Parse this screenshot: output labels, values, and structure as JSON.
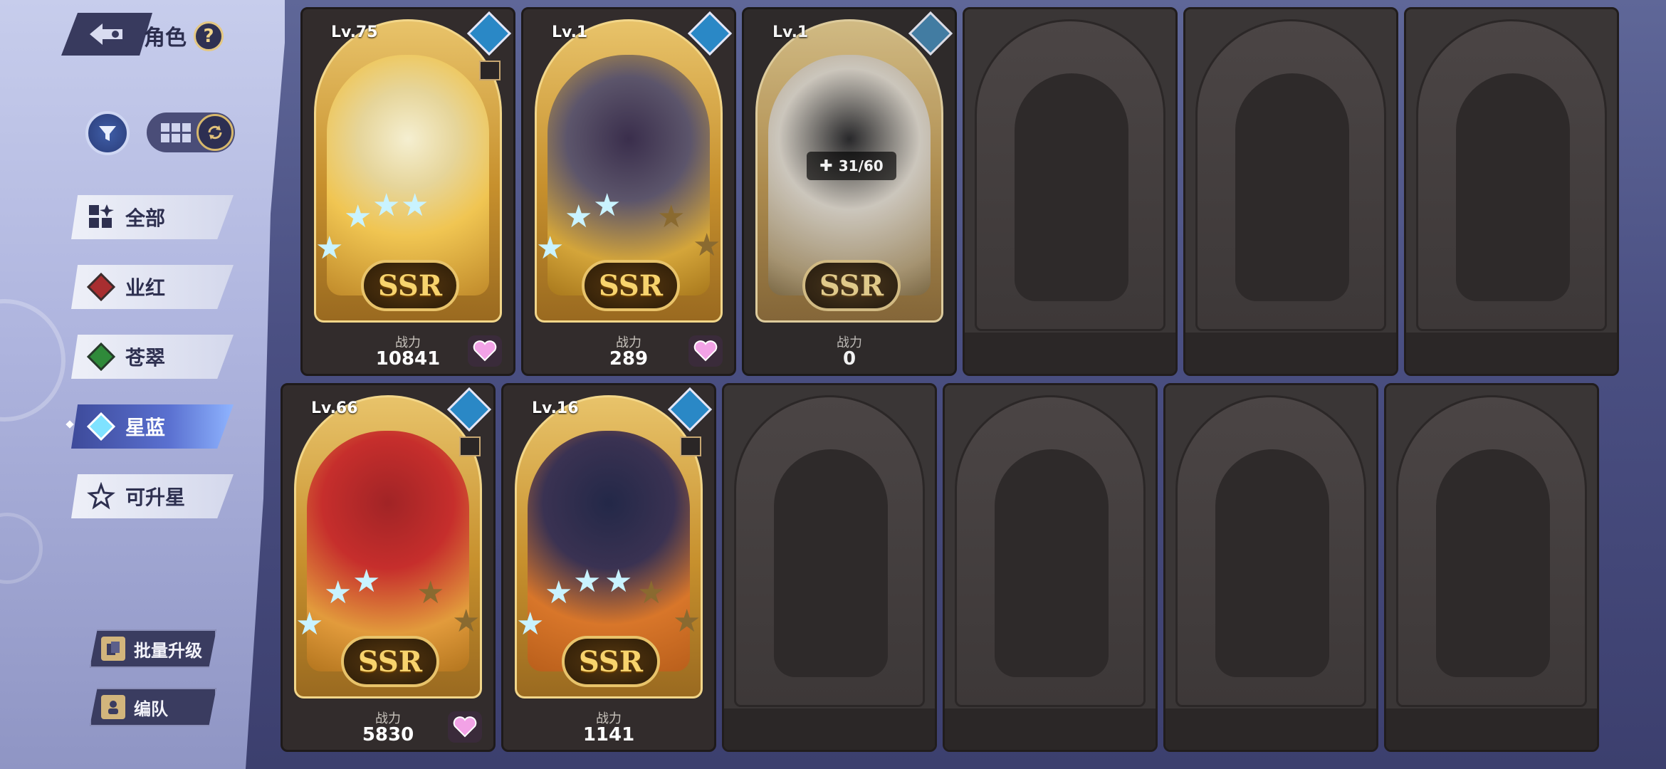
{
  "header": {
    "title": "角色",
    "help": "?"
  },
  "categories": [
    {
      "label": "全部",
      "icon": "all-grid-icon",
      "color": "#2e3050",
      "active": false
    },
    {
      "label": "业红",
      "icon": "red-diamond-icon",
      "color": "#b03232",
      "active": false
    },
    {
      "label": "苍翠",
      "icon": "green-diamond-icon",
      "color": "#2f8a3a",
      "active": false
    },
    {
      "label": "星蓝",
      "icon": "blue-diamond-icon",
      "color": "#5ad0f0",
      "active": true
    },
    {
      "label": "可升星",
      "icon": "star-up-icon",
      "color": "#2e3050",
      "active": false
    }
  ],
  "bottom_buttons": {
    "batch_upgrade": "批量升级",
    "team": "编队"
  },
  "cards": [
    {
      "level": "Lv.75",
      "rarity": "SSR",
      "power_label": "战力",
      "power": "10841",
      "stars": 3,
      "element": "blue",
      "favorite": true
    },
    {
      "level": "Lv.1",
      "rarity": "SSR",
      "power_label": "战力",
      "power": "289",
      "stars": 3,
      "element": "blue",
      "favorite": true
    },
    {
      "level": "Lv.1",
      "rarity": "SSR",
      "power_label": "战力",
      "power": "0",
      "stars": 0,
      "element": "blue",
      "favorite": false,
      "fragment": "31/60"
    },
    {
      "level": "Lv.66",
      "rarity": "SSR",
      "power_label": "战力",
      "power": "5830",
      "stars": 3,
      "element": "blue",
      "favorite": true
    },
    {
      "level": "Lv.16",
      "rarity": "SSR",
      "power_label": "战力",
      "power": "1141",
      "stars": 4,
      "element": "blue",
      "favorite": false
    }
  ]
}
